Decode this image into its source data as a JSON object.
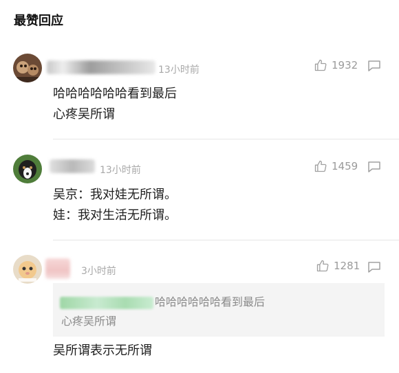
{
  "section_title": "最赞回应",
  "comments": [
    {
      "time": "13小时前",
      "likes": "1932",
      "lines": [
        "哈哈哈哈哈哈看到最后",
        "心疼吴所谓"
      ]
    },
    {
      "time": "13小时前",
      "likes": "1459",
      "lines": [
        "吴京：我对娃无所谓。",
        "娃：我对生活无所谓。"
      ]
    },
    {
      "time": "3小时前",
      "likes": "1281",
      "quote": {
        "line1": "哈哈哈哈哈哈看到最后",
        "line2": "心疼吴所谓"
      },
      "lines": [
        "吴所谓表示无所谓"
      ]
    }
  ],
  "icons": {
    "like": "thumbs-up-icon",
    "reply": "comment-bubble-icon"
  },
  "colors": {
    "meta_text": "#a8a8a8",
    "divider": "#e6e6e6",
    "quote_bg": "#f4f4f4"
  }
}
